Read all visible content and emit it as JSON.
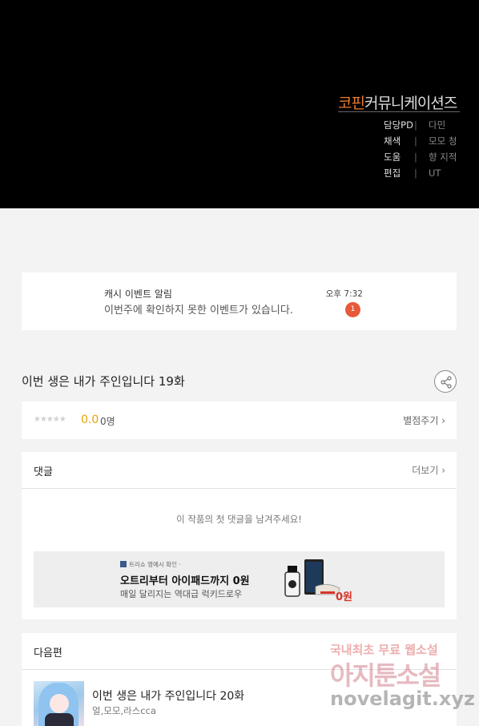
{
  "credits": {
    "studio_highlight": "코핀",
    "studio_rest": "커뮤니케이션즈",
    "rows": [
      {
        "role": "담당PD",
        "sep": "|",
        "value": "다민"
      },
      {
        "role": "채색",
        "sep": "|",
        "value": "모모 청"
      },
      {
        "role": "도움",
        "sep": "|",
        "value": "향 지적"
      },
      {
        "role": "편집",
        "sep": "|",
        "value": "UT"
      }
    ]
  },
  "notice": {
    "title": "캐시 이벤트 알림",
    "message": "이번주에 확인하지 못한 이벤트가 있습니다.",
    "time": "오후 7:32",
    "badge": "1"
  },
  "episode": {
    "title": "이번 생은 내가 주인입니다 19화",
    "share_icon": "share-icon"
  },
  "rating": {
    "stars": "★★★★★",
    "score": "0.0",
    "count": "0명",
    "rate_label": "별점주기 ›",
    "score_color": "#e8a400"
  },
  "comments": {
    "title": "댓글",
    "more_label": "더보기 ›",
    "empty_message": "이 작품의 첫 댓글을 남겨주세요!"
  },
  "ad": {
    "brand": "트리쇼 영예시 확인 ·",
    "title": "오트리부터 아이패드까지 0원",
    "subtitle": "매일 달리지는 역대급 럭키드로우",
    "price": "0원"
  },
  "next_episode": {
    "section_title": "다음편",
    "title": "이번 생은 내가 주인입니다 20화",
    "authors": "얼,모모,라스cca"
  },
  "watermark": {
    "line1": "국내최초 무료 웹소설",
    "line2": "아지툰소설",
    "line3": "novelagit.xyz"
  },
  "colors": {
    "accent_orange": "#e87b2e",
    "badge_red": "#e8593a",
    "price_red": "#d8342a"
  }
}
